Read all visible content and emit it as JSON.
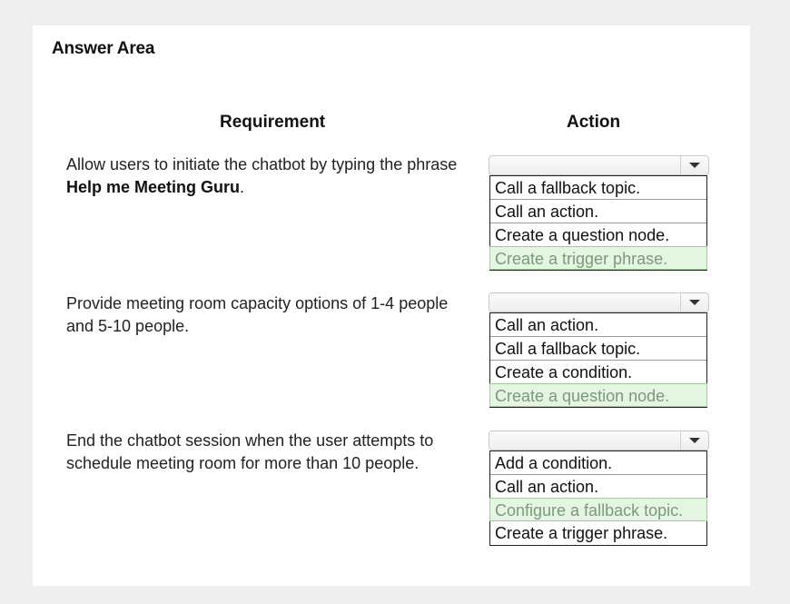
{
  "title": "Answer Area",
  "columns": {
    "requirement": "Requirement",
    "action": "Action"
  },
  "rows": [
    {
      "requirement_pre": "Allow users to initiate the chatbot by typing the phrase ",
      "requirement_bold": "Help me Meeting Guru",
      "requirement_post": ".",
      "dropdown": {
        "selected_value": "",
        "options": [
          {
            "label": "Call a fallback topic.",
            "selected": false
          },
          {
            "label": "Call an action.",
            "selected": false
          },
          {
            "label": "Create a question node.",
            "selected": false
          },
          {
            "label": "Create a trigger phrase.",
            "selected": true
          }
        ]
      }
    },
    {
      "requirement_pre": "Provide meeting room capacity options of 1-4 people and 5-10 people.",
      "requirement_bold": "",
      "requirement_post": "",
      "dropdown": {
        "selected_value": "",
        "options": [
          {
            "label": "Call an action.",
            "selected": false
          },
          {
            "label": "Call a fallback topic.",
            "selected": false
          },
          {
            "label": "Create a condition.",
            "selected": false
          },
          {
            "label": "Create a question node.",
            "selected": true
          }
        ]
      }
    },
    {
      "requirement_pre": "End the chatbot session when the user attempts to schedule meeting room for more than 10 people.",
      "requirement_bold": "",
      "requirement_post": "",
      "dropdown": {
        "selected_value": "",
        "options": [
          {
            "label": "Add a condition.",
            "selected": false
          },
          {
            "label": "Call an action.",
            "selected": false
          },
          {
            "label": "Configure a fallback topic.",
            "selected": true
          },
          {
            "label": "Create a trigger phrase.",
            "selected": false
          }
        ]
      }
    }
  ],
  "icons": {
    "dropdown_arrow": "chevron-down-icon"
  },
  "colors": {
    "page_background": "#efefef",
    "panel_background": "#ffffff",
    "selected_option_background": "#e4f5e2",
    "selected_option_text": "#7a9a7a"
  }
}
